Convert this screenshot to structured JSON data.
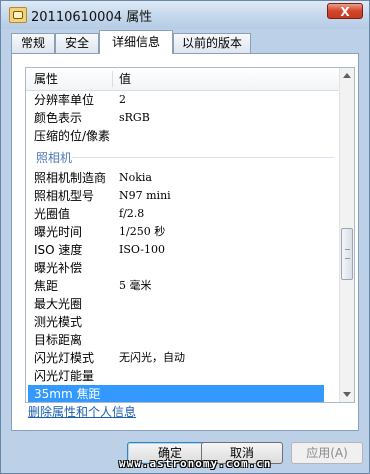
{
  "window": {
    "title": "20110610004 属性",
    "close_label": "X"
  },
  "tabs": [
    {
      "label": "常规",
      "active": false
    },
    {
      "label": "安全",
      "active": false
    },
    {
      "label": "详细信息",
      "active": true
    },
    {
      "label": "以前的版本",
      "active": false
    }
  ],
  "list": {
    "columns": {
      "property": "属性",
      "value": "值"
    },
    "rows_top": [
      {
        "key": "分辨率单位",
        "value": "2"
      },
      {
        "key": "颜色表示",
        "value": "sRGB"
      },
      {
        "key": "压缩的位/像素",
        "value": ""
      }
    ],
    "section_camera": "照相机",
    "rows_camera": [
      {
        "key": "照相机制造商",
        "value": "Nokia"
      },
      {
        "key": "照相机型号",
        "value": "N97 mini"
      },
      {
        "key": "光圈值",
        "value": "f/2.8"
      },
      {
        "key": "曝光时间",
        "value": "1/250 秒"
      },
      {
        "key": "ISO 速度",
        "value": "ISO-100"
      },
      {
        "key": "曝光补偿",
        "value": ""
      },
      {
        "key": "焦距",
        "value": "5 毫米"
      },
      {
        "key": "最大光圈",
        "value": ""
      },
      {
        "key": "测光模式",
        "value": ""
      },
      {
        "key": "目标距离",
        "value": ""
      },
      {
        "key": "闪光灯模式",
        "value": "无闪光，自动"
      },
      {
        "key": "闪光灯能量",
        "value": ""
      },
      {
        "key": "35mm 焦距",
        "value": "",
        "selected": true
      }
    ]
  },
  "link": {
    "remove_properties": "删除属性和个人信息"
  },
  "buttons": {
    "ok": "确定",
    "cancel": "取消",
    "apply": "应用(A)"
  },
  "watermark": "www.astronomy.com.cn"
}
